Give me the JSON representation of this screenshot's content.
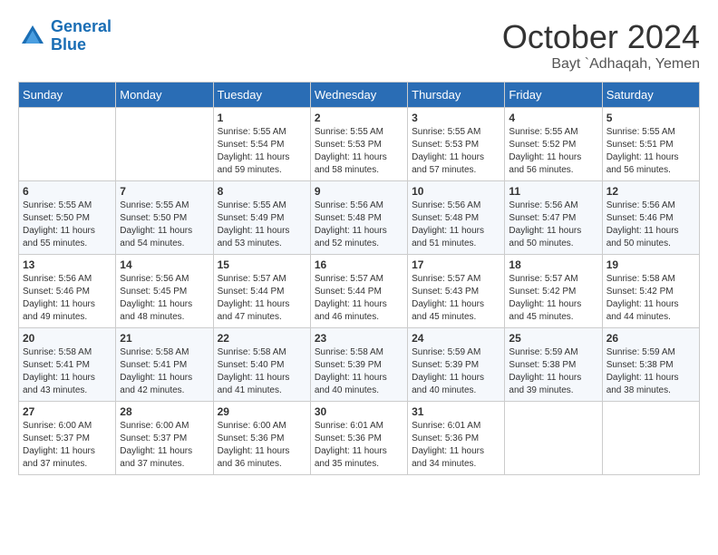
{
  "logo": {
    "line1": "General",
    "line2": "Blue"
  },
  "title": "October 2024",
  "subtitle": "Bayt `Adhaqah, Yemen",
  "days_of_week": [
    "Sunday",
    "Monday",
    "Tuesday",
    "Wednesday",
    "Thursday",
    "Friday",
    "Saturday"
  ],
  "weeks": [
    [
      {
        "day": "",
        "info": ""
      },
      {
        "day": "",
        "info": ""
      },
      {
        "day": "1",
        "info": "Sunrise: 5:55 AM\nSunset: 5:54 PM\nDaylight: 11 hours and 59 minutes."
      },
      {
        "day": "2",
        "info": "Sunrise: 5:55 AM\nSunset: 5:53 PM\nDaylight: 11 hours and 58 minutes."
      },
      {
        "day": "3",
        "info": "Sunrise: 5:55 AM\nSunset: 5:53 PM\nDaylight: 11 hours and 57 minutes."
      },
      {
        "day": "4",
        "info": "Sunrise: 5:55 AM\nSunset: 5:52 PM\nDaylight: 11 hours and 56 minutes."
      },
      {
        "day": "5",
        "info": "Sunrise: 5:55 AM\nSunset: 5:51 PM\nDaylight: 11 hours and 56 minutes."
      }
    ],
    [
      {
        "day": "6",
        "info": "Sunrise: 5:55 AM\nSunset: 5:50 PM\nDaylight: 11 hours and 55 minutes."
      },
      {
        "day": "7",
        "info": "Sunrise: 5:55 AM\nSunset: 5:50 PM\nDaylight: 11 hours and 54 minutes."
      },
      {
        "day": "8",
        "info": "Sunrise: 5:55 AM\nSunset: 5:49 PM\nDaylight: 11 hours and 53 minutes."
      },
      {
        "day": "9",
        "info": "Sunrise: 5:56 AM\nSunset: 5:48 PM\nDaylight: 11 hours and 52 minutes."
      },
      {
        "day": "10",
        "info": "Sunrise: 5:56 AM\nSunset: 5:48 PM\nDaylight: 11 hours and 51 minutes."
      },
      {
        "day": "11",
        "info": "Sunrise: 5:56 AM\nSunset: 5:47 PM\nDaylight: 11 hours and 50 minutes."
      },
      {
        "day": "12",
        "info": "Sunrise: 5:56 AM\nSunset: 5:46 PM\nDaylight: 11 hours and 50 minutes."
      }
    ],
    [
      {
        "day": "13",
        "info": "Sunrise: 5:56 AM\nSunset: 5:46 PM\nDaylight: 11 hours and 49 minutes."
      },
      {
        "day": "14",
        "info": "Sunrise: 5:56 AM\nSunset: 5:45 PM\nDaylight: 11 hours and 48 minutes."
      },
      {
        "day": "15",
        "info": "Sunrise: 5:57 AM\nSunset: 5:44 PM\nDaylight: 11 hours and 47 minutes."
      },
      {
        "day": "16",
        "info": "Sunrise: 5:57 AM\nSunset: 5:44 PM\nDaylight: 11 hours and 46 minutes."
      },
      {
        "day": "17",
        "info": "Sunrise: 5:57 AM\nSunset: 5:43 PM\nDaylight: 11 hours and 45 minutes."
      },
      {
        "day": "18",
        "info": "Sunrise: 5:57 AM\nSunset: 5:42 PM\nDaylight: 11 hours and 45 minutes."
      },
      {
        "day": "19",
        "info": "Sunrise: 5:58 AM\nSunset: 5:42 PM\nDaylight: 11 hours and 44 minutes."
      }
    ],
    [
      {
        "day": "20",
        "info": "Sunrise: 5:58 AM\nSunset: 5:41 PM\nDaylight: 11 hours and 43 minutes."
      },
      {
        "day": "21",
        "info": "Sunrise: 5:58 AM\nSunset: 5:41 PM\nDaylight: 11 hours and 42 minutes."
      },
      {
        "day": "22",
        "info": "Sunrise: 5:58 AM\nSunset: 5:40 PM\nDaylight: 11 hours and 41 minutes."
      },
      {
        "day": "23",
        "info": "Sunrise: 5:58 AM\nSunset: 5:39 PM\nDaylight: 11 hours and 40 minutes."
      },
      {
        "day": "24",
        "info": "Sunrise: 5:59 AM\nSunset: 5:39 PM\nDaylight: 11 hours and 40 minutes."
      },
      {
        "day": "25",
        "info": "Sunrise: 5:59 AM\nSunset: 5:38 PM\nDaylight: 11 hours and 39 minutes."
      },
      {
        "day": "26",
        "info": "Sunrise: 5:59 AM\nSunset: 5:38 PM\nDaylight: 11 hours and 38 minutes."
      }
    ],
    [
      {
        "day": "27",
        "info": "Sunrise: 6:00 AM\nSunset: 5:37 PM\nDaylight: 11 hours and 37 minutes."
      },
      {
        "day": "28",
        "info": "Sunrise: 6:00 AM\nSunset: 5:37 PM\nDaylight: 11 hours and 37 minutes."
      },
      {
        "day": "29",
        "info": "Sunrise: 6:00 AM\nSunset: 5:36 PM\nDaylight: 11 hours and 36 minutes."
      },
      {
        "day": "30",
        "info": "Sunrise: 6:01 AM\nSunset: 5:36 PM\nDaylight: 11 hours and 35 minutes."
      },
      {
        "day": "31",
        "info": "Sunrise: 6:01 AM\nSunset: 5:36 PM\nDaylight: 11 hours and 34 minutes."
      },
      {
        "day": "",
        "info": ""
      },
      {
        "day": "",
        "info": ""
      }
    ]
  ]
}
